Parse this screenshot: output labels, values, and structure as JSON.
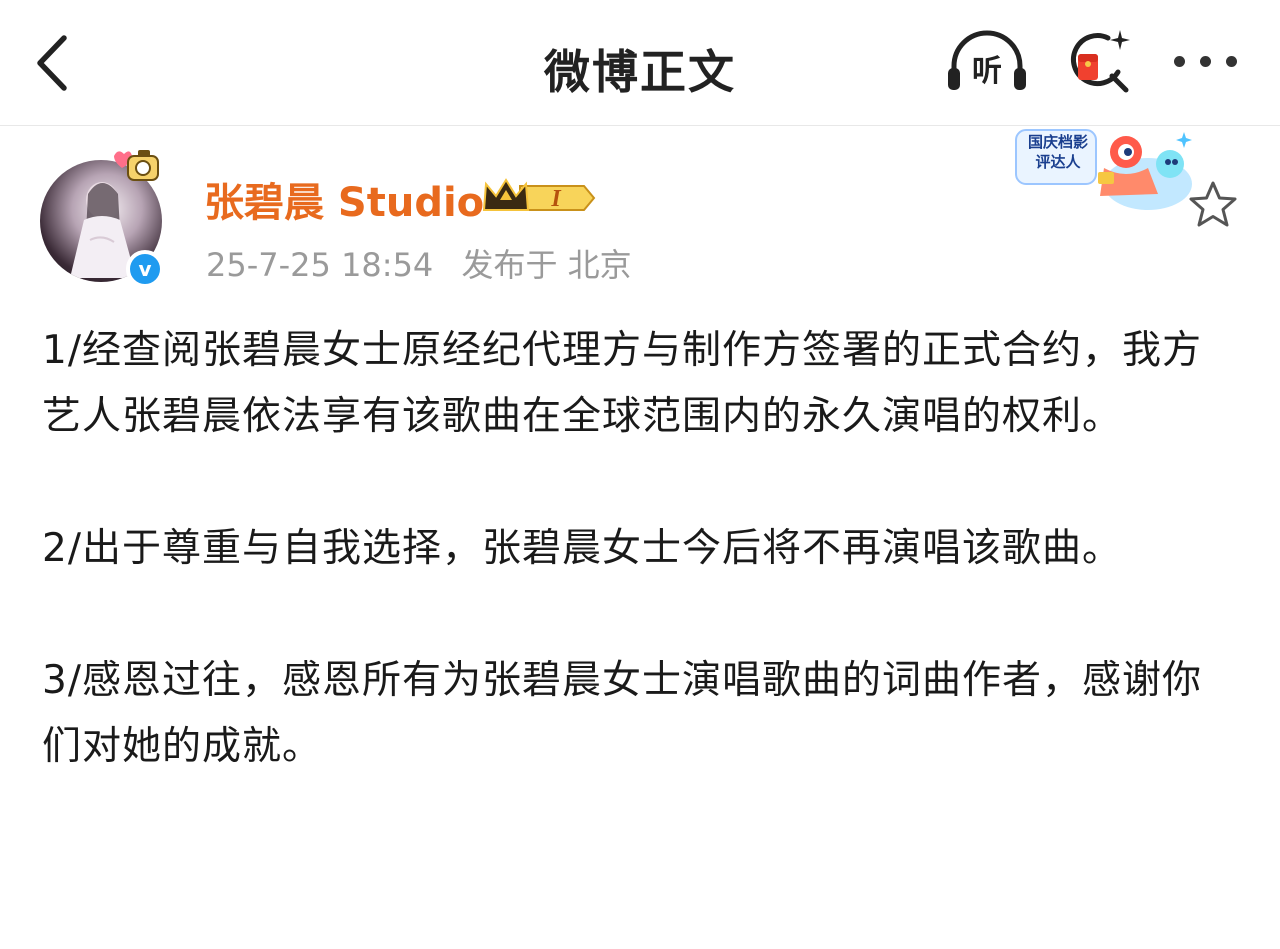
{
  "nav": {
    "title": "微博正文",
    "listen_label": "听",
    "icons": [
      "back-icon",
      "headphones-icon",
      "search-redpacket-icon",
      "more-icon"
    ]
  },
  "author": {
    "name": "张碧晨 Studio",
    "vip_level": "I",
    "verified": true,
    "verified_mark": "v",
    "timestamp": "25-7-25 18:54",
    "location": "发布于 北京",
    "event_sticker_text": "国庆档影评达人"
  },
  "post": {
    "paragraphs": [
      "1/经查阅张碧晨女士原经纪代理方与制作方签署的正式合约，我方艺人张碧晨依法享有该歌曲在全球范围内的永久演唱的权利。",
      "2/出于尊重与自我选择，张碧晨女士今后将不再演唱该歌曲。",
      "3/感恩过往，感恩所有为张碧晨女士演唱歌曲的词曲作者，感谢你们对她的成就。"
    ]
  },
  "colors": {
    "username": "#e86a1e",
    "meta": "#9a9a9a",
    "verified": "#1f9bf0",
    "vip_gold": "#f5c33b"
  }
}
